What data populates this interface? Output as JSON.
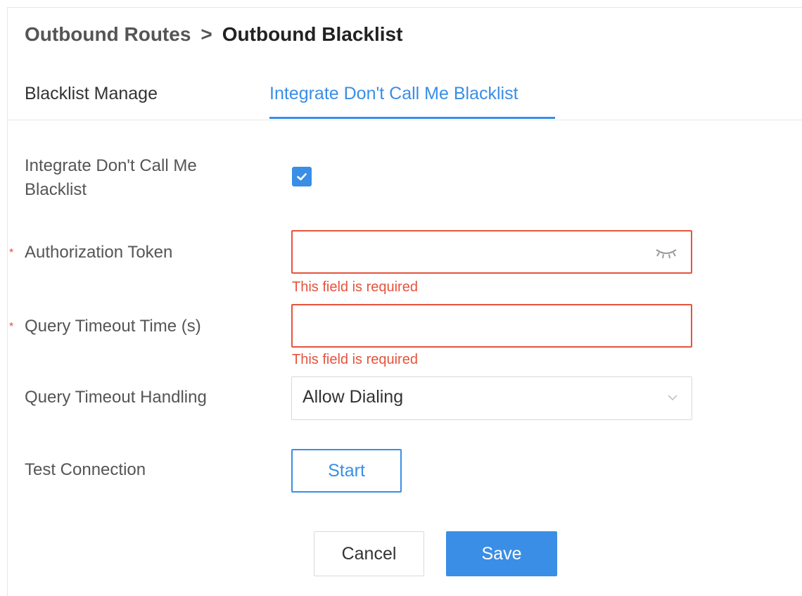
{
  "breadcrumb": {
    "parent": "Outbound Routes",
    "separator": ">",
    "current": "Outbound Blacklist"
  },
  "tabs": [
    {
      "label": "Blacklist Manage",
      "active": false
    },
    {
      "label": "Integrate Don't Call Me Blacklist",
      "active": true
    }
  ],
  "form": {
    "required_mark": "*",
    "integrate": {
      "label": "Integrate Don't Call Me Blacklist",
      "checked": true
    },
    "auth_token": {
      "label": "Authorization Token",
      "value": "",
      "error": "This field is required",
      "icon": "eye-closed-icon"
    },
    "query_timeout_time": {
      "label": "Query Timeout Time (s)",
      "value": "",
      "error": "This field is required"
    },
    "query_timeout_handling": {
      "label": "Query Timeout Handling",
      "selected": "Allow Dialing",
      "icon": "chevron-down-icon"
    },
    "test_connection": {
      "label": "Test Connection",
      "button_label": "Start"
    }
  },
  "actions": {
    "cancel_label": "Cancel",
    "save_label": "Save"
  },
  "colors": {
    "accent": "#3a8ee6",
    "error": "#e5533d",
    "text": "#333333",
    "muted_text": "#555555",
    "border": "#d9d9d9"
  }
}
